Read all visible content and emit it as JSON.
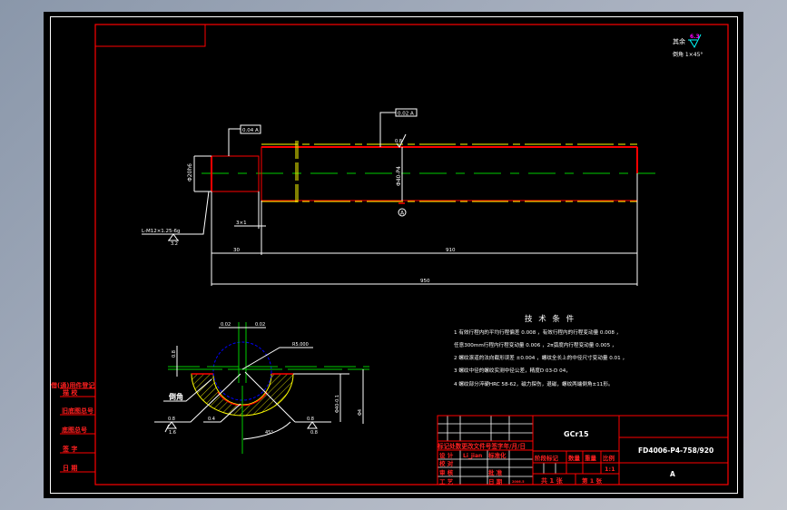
{
  "colors": {
    "background": "#000000",
    "frame": "#ff0000",
    "outline": "#ffffff",
    "centerline": "#00cc00",
    "hidden": "#ffff00",
    "circle": "#0000ff",
    "roughness_value": "#ff00ff",
    "roughness_symbol": "#00ffff"
  },
  "roughness": {
    "label": "其余",
    "value": "6.3",
    "chamfer": "倒角 1×45°"
  },
  "main_view": {
    "gdt_left": "0.04 A",
    "gdt_right": "0.02 A",
    "roughness_top": "0.8",
    "dia_left": "Φ20h6",
    "dia_main": "Φ40-P4",
    "datum": "A",
    "thread_note": "L-M12×1.25-6g",
    "thread_roughness": "3.2",
    "undercut": "3×1",
    "dim_short": "30",
    "dim_long": "910",
    "dim_total": "950"
  },
  "section_view": {
    "tol_left": "0.02",
    "tol_right": "0.02",
    "radius": "R5.000",
    "chamfer": "倒角",
    "left_vertical": "0.8",
    "rough_left": "0.8",
    "rough_left_sym": "1.6",
    "rough_mid": "0.4",
    "rough_right": "0.8",
    "rough_right_sym": "0.8",
    "angle": "45°",
    "dim_right": "Φ40-0.1",
    "dim_far": "Φ4"
  },
  "tech": {
    "title": "技 术 条 件",
    "lines": [
      "1  有效行程内的平均行程偏差 0.008 ，有效行程内的行程变动量 0.008 ，",
      "    任意300mm行程内行程变动量 0.006 ，2π弧度内行程变动量 0.005 ，",
      "2  螺纹滚道的法向截形误差 ±0.004 ，螺纹全长上的中径尺寸变动量 0.01 ，",
      "3  螺纹中径的螺纹实测中径公差，精度D 03-D 04，",
      "4  螺纹部分淬硬HRC 58-62，磁力探伤，退磁，螺纹两端倒角±11形。"
    ]
  },
  "left_strip": [
    "借(通)用件登记",
    "描    校",
    "旧底图总号",
    "底图总号",
    "签    字",
    "日    期"
  ],
  "title_block": {
    "material": "GCr15",
    "drawing_no": "FD4006-P4-758/920",
    "code": "A",
    "rev_header": "标记处数更改文件号签字年/月/日",
    "design": "设  计",
    "designer": "Li_jian",
    "standard": "标准化",
    "check": "校  对",
    "review": "审  核",
    "approve": "批  准",
    "process": "工  艺",
    "date": "日  期",
    "date_value": "2006.5",
    "stage": "阶段标记",
    "qty": "数量",
    "weight": "重量",
    "scale_label": "比例",
    "scale": "1:1",
    "sheets": "共 1 张",
    "sheet": "第 1 张"
  }
}
